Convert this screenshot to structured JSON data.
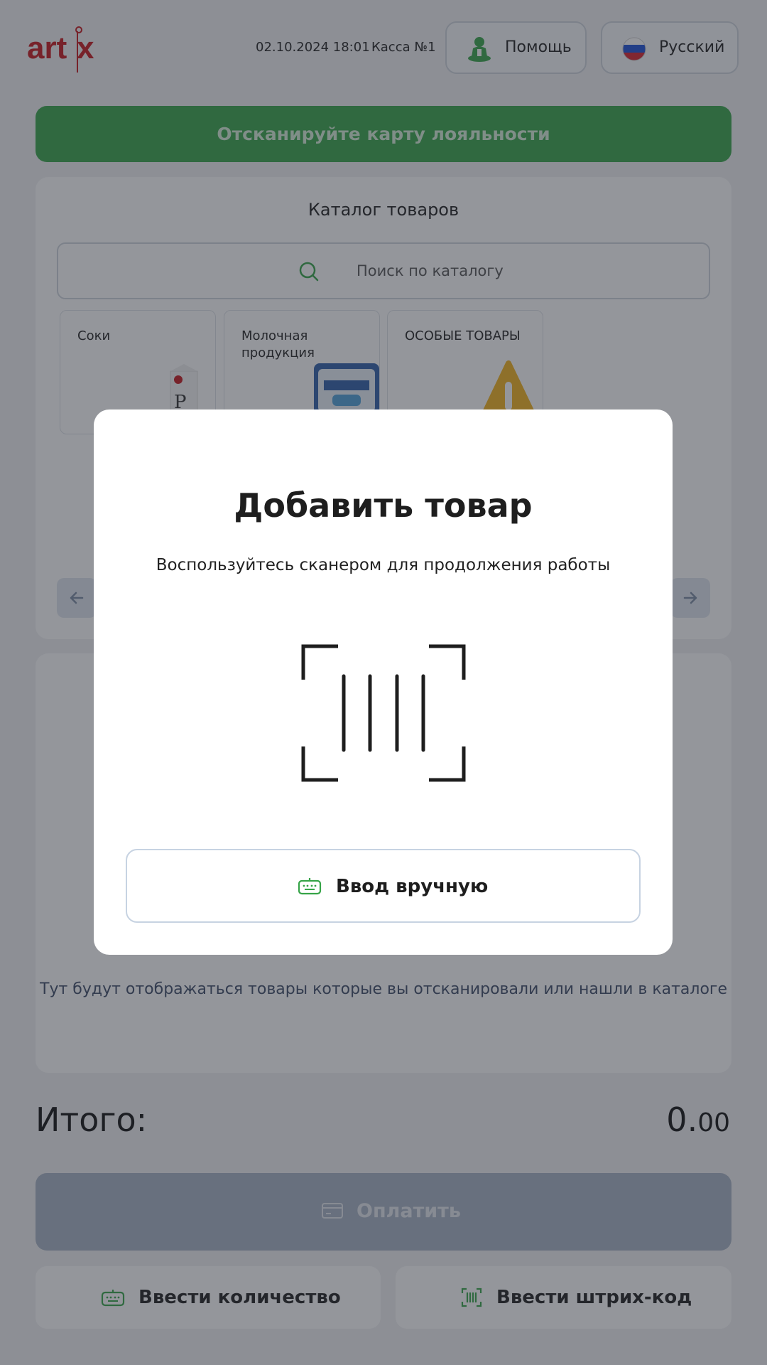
{
  "header": {
    "logo_text": "artx",
    "datetime": "02.10.2024 18:01",
    "register": "Касса №1",
    "help_label": "Помощь",
    "help_icon": "person-help-icon",
    "language_label": "Русский",
    "language_icon": "russia-flag-icon"
  },
  "loyalty": {
    "label": "Отсканируйте карту лояльности"
  },
  "catalog": {
    "title": "Каталог товаров",
    "search_placeholder": "Поиск по каталогу",
    "categories": [
      {
        "label": "Соки",
        "image": "juice-carton"
      },
      {
        "label": "Молочная продукция",
        "image": "milk-package"
      },
      {
        "label": "ОСОБЫЕ ТОВАРЫ",
        "image": "warning-sign"
      }
    ]
  },
  "cart": {
    "empty_text": "Тут будут отображаться товары которые вы отсканировали или нашли в каталоге"
  },
  "total": {
    "label": "Итого:",
    "integer": "0.",
    "decimal": "00"
  },
  "actions": {
    "pay_label": "Оплатить",
    "enter_quantity_label": "Ввести количество",
    "enter_barcode_label": "Ввести штрих-код"
  },
  "modal": {
    "title": "Добавить товар",
    "subtitle": "Воспользуйтесь сканером для продолжения работы",
    "manual_input_label": "Ввод вручную"
  },
  "colors": {
    "accent_green": "#36a448",
    "brand_red": "#c4161c",
    "pay_disabled": "#a7b3c5"
  }
}
